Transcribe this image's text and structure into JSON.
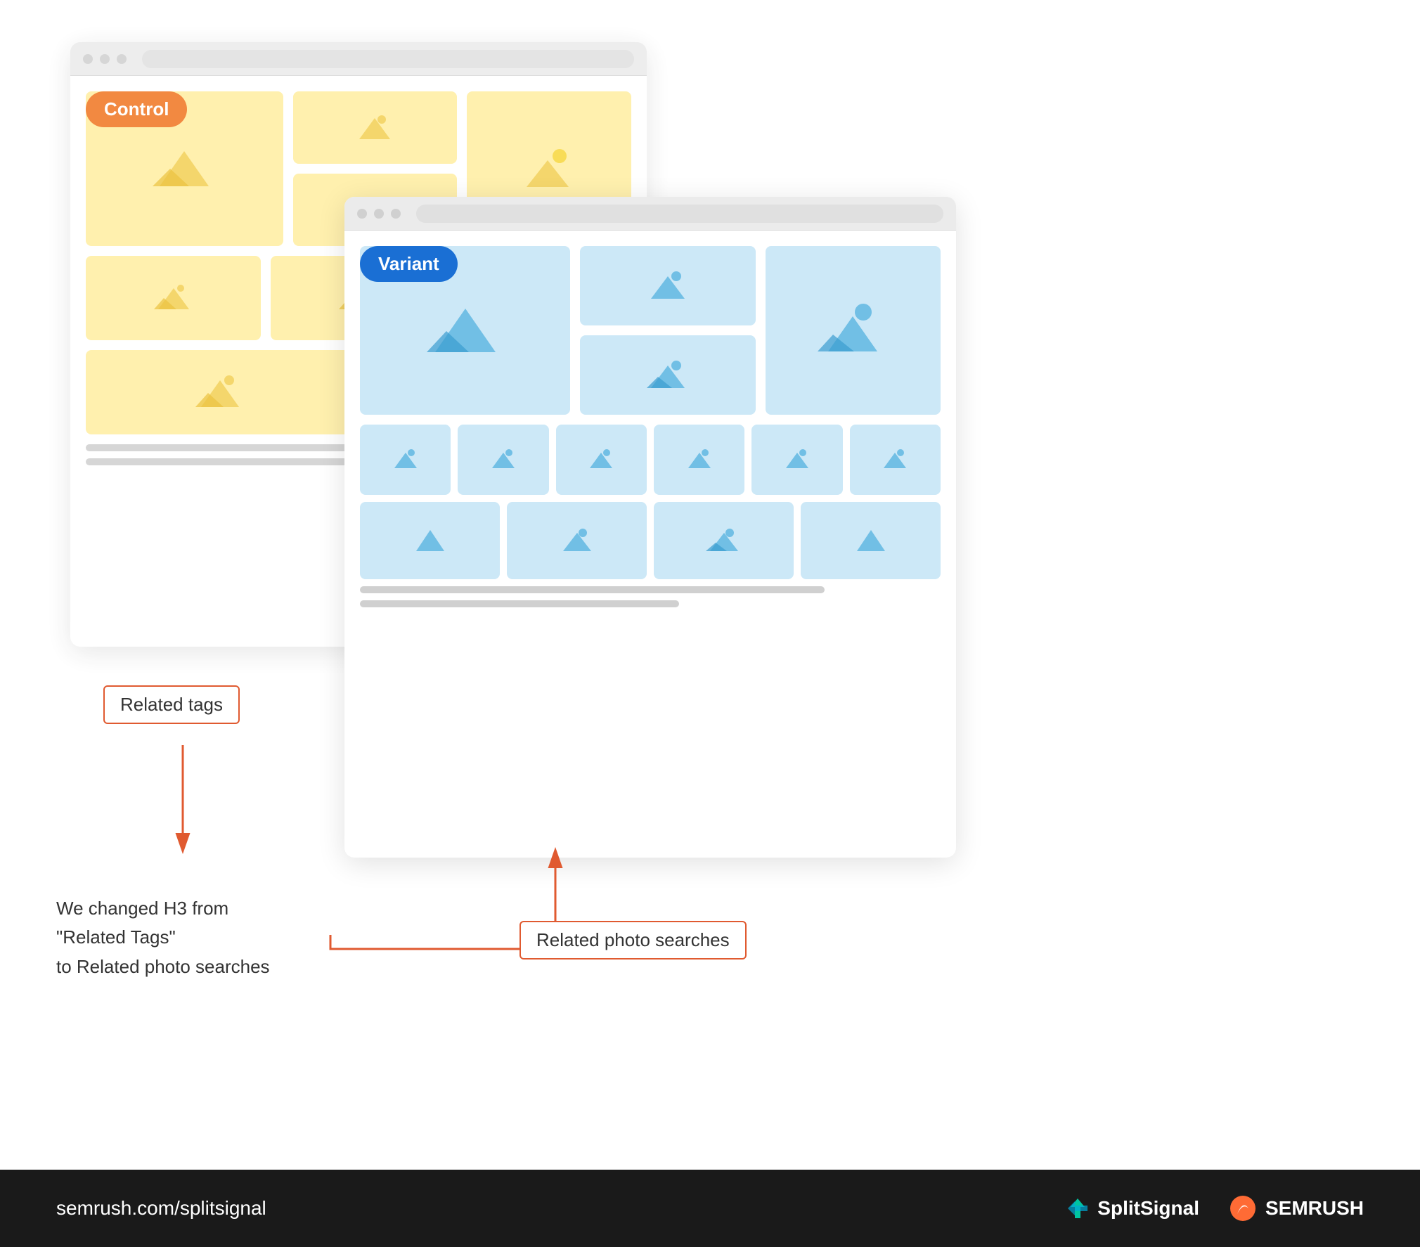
{
  "control": {
    "badge": "Control",
    "badge_color": "#f07520"
  },
  "variant": {
    "badge": "Variant",
    "badge_color": "#1a6fd4"
  },
  "annotations": {
    "related_tags": "Related tags",
    "related_photo_searches": "Related photo searches",
    "explanation": "We changed H3 from\n\"Related Tags\"\nto Related photo searches"
  },
  "footer": {
    "url": "semrush.com/splitsignal",
    "splitsignal_label": "SplitSignal",
    "semrush_label": "SEMRUSH"
  }
}
